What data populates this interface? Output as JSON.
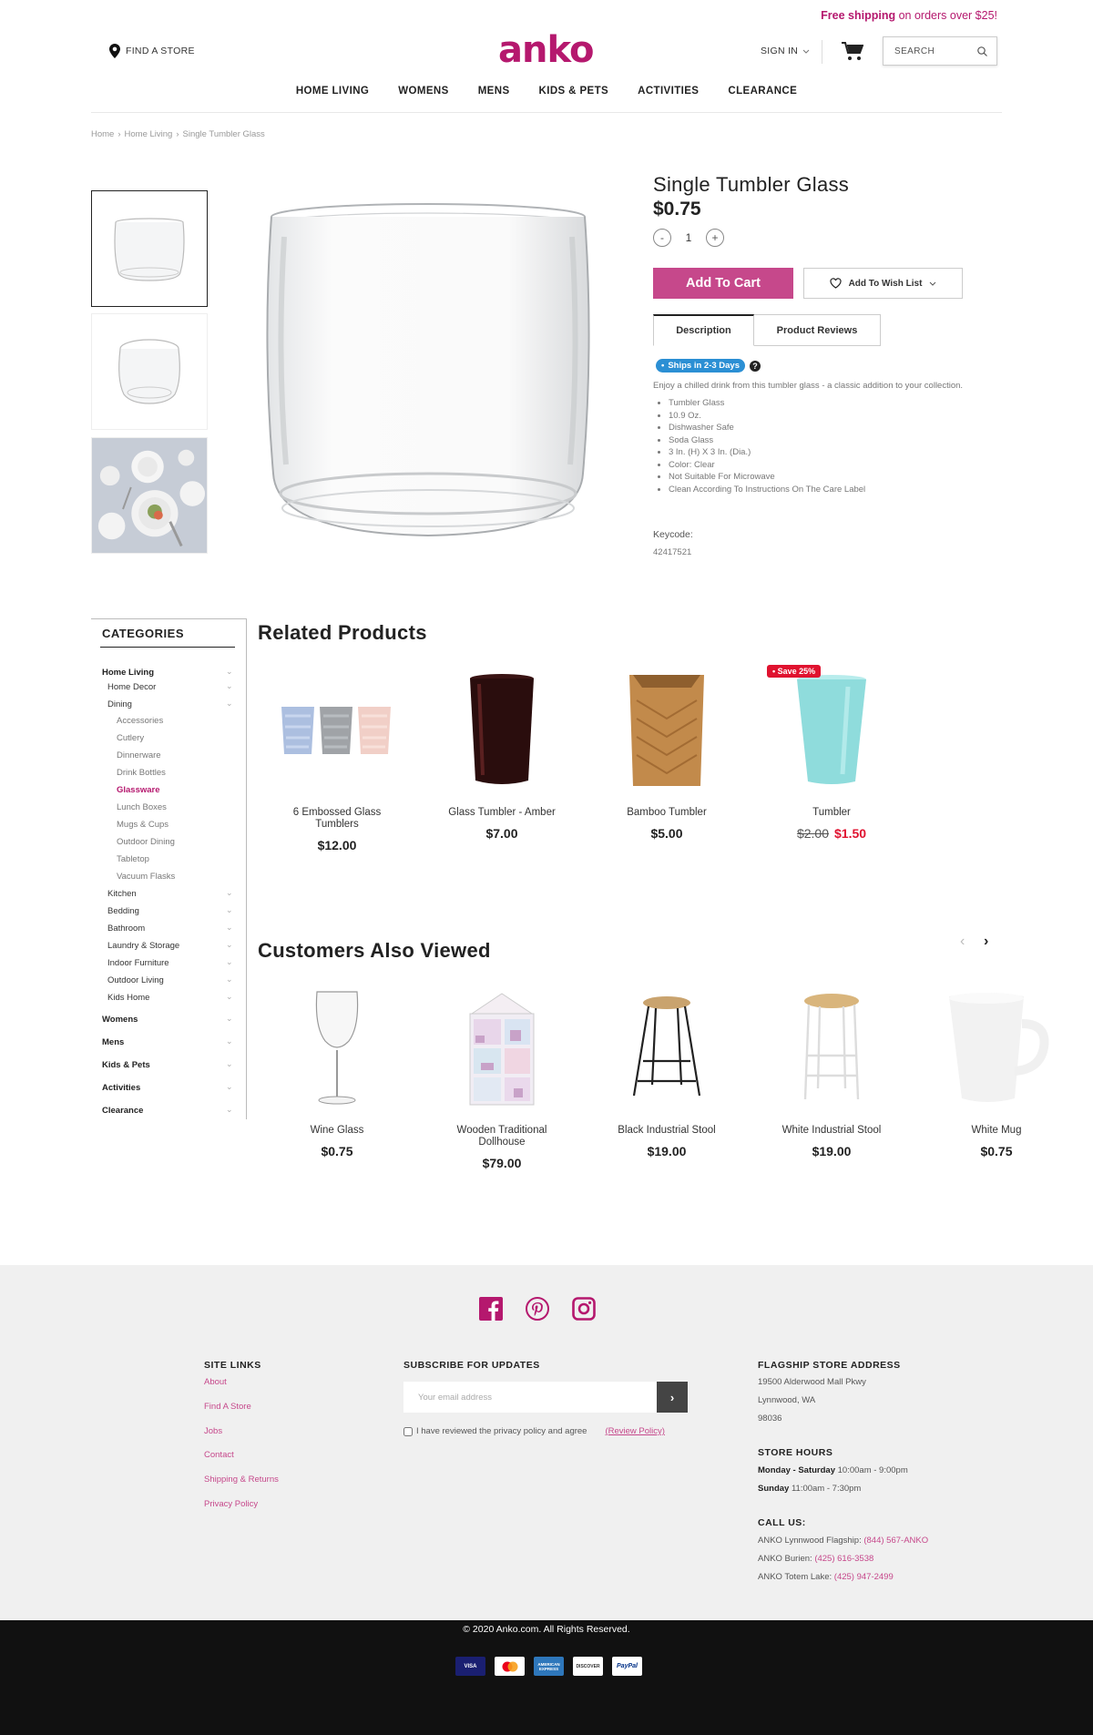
{
  "header": {
    "promo_bold": "Free shipping",
    "promo_rest": " on orders over $25!",
    "find_store": "FIND A STORE",
    "logo": "anko",
    "sign_in": "SIGN IN",
    "search_placeholder": "SEARCH",
    "nav": [
      "HOME LIVING",
      "WOMENS",
      "MENS",
      "KIDS & PETS",
      "ACTIVITIES",
      "CLEARANCE"
    ]
  },
  "breadcrumb": [
    "Home",
    "Home Living",
    "Single Tumbler Glass"
  ],
  "product": {
    "title": "Single Tumbler Glass",
    "price": "$0.75",
    "qty_minus": "-",
    "qty": "1",
    "qty_plus": "+",
    "add_to_cart": "Add To Cart",
    "wish_list": "Add To Wish List",
    "tabs": [
      "Description",
      "Product Reviews"
    ],
    "ships": "Ships in 2-3 Days",
    "help": "?",
    "description": "Enjoy a chilled drink from this tumbler glass - a classic addition to your collection.",
    "features": [
      "Tumbler Glass",
      "10.9 Oz.",
      "Dishwasher Safe",
      "Soda Glass",
      "3 In. (H) X 3 In. (Dia.)",
      "Color: Clear",
      "Not Suitable For Microwave",
      "Clean According To Instructions On The Care Label"
    ],
    "keycode_label": "Keycode:",
    "keycode": "42417521"
  },
  "categories": {
    "title": "CATEGORIES",
    "items": [
      {
        "label": "Home Living",
        "level": 1
      },
      {
        "label": "Home Decor",
        "level": 2
      },
      {
        "label": "Dining",
        "level": 2
      },
      {
        "label": "Accessories",
        "level": 3
      },
      {
        "label": "Cutlery",
        "level": 3
      },
      {
        "label": "Dinnerware",
        "level": 3
      },
      {
        "label": "Drink Bottles",
        "level": 3
      },
      {
        "label": "Glassware",
        "level": 3,
        "active": true
      },
      {
        "label": "Lunch Boxes",
        "level": 3
      },
      {
        "label": "Mugs & Cups",
        "level": 3
      },
      {
        "label": "Outdoor Dining",
        "level": 3
      },
      {
        "label": "Tabletop",
        "level": 3
      },
      {
        "label": "Vacuum Flasks",
        "level": 3
      },
      {
        "label": "Kitchen",
        "level": 2
      },
      {
        "label": "Bedding",
        "level": 2
      },
      {
        "label": "Bathroom",
        "level": 2
      },
      {
        "label": "Laundry & Storage",
        "level": 2
      },
      {
        "label": "Indoor Furniture",
        "level": 2
      },
      {
        "label": "Outdoor Living",
        "level": 2
      },
      {
        "label": "Kids Home",
        "level": 2
      },
      {
        "label": "Womens",
        "level": 1
      },
      {
        "label": "Mens",
        "level": 1
      },
      {
        "label": "Kids & Pets",
        "level": 1
      },
      {
        "label": "Activities",
        "level": 1
      },
      {
        "label": "Clearance",
        "level": 1
      }
    ]
  },
  "related": {
    "title": "Related Products",
    "items": [
      {
        "name": "6 Embossed Glass Tumblers",
        "price": "$12.00"
      },
      {
        "name": "Glass Tumbler - Amber",
        "price": "$7.00"
      },
      {
        "name": "Bamboo Tumbler",
        "price": "$5.00"
      },
      {
        "name": "Tumbler",
        "old_price": "$2.00",
        "price": "$1.50",
        "badge": "Save 25%"
      }
    ]
  },
  "also_viewed": {
    "title": "Customers Also Viewed",
    "prev": "‹",
    "next": "›",
    "items": [
      {
        "name": "Wine Glass",
        "price": "$0.75"
      },
      {
        "name": "Wooden Traditional Dollhouse",
        "price": "$79.00"
      },
      {
        "name": "Black Industrial Stool",
        "price": "$19.00"
      },
      {
        "name": "White Industrial Stool",
        "price": "$19.00"
      },
      {
        "name": "White Mug",
        "price": "$0.75"
      }
    ]
  },
  "footer": {
    "site_links_title": "SITE LINKS",
    "site_links": [
      "About",
      "Find A Store",
      "Jobs",
      "Contact",
      "Shipping & Returns",
      "Privacy Policy"
    ],
    "subscribe_title": "SUBSCRIBE FOR UPDATES",
    "email_placeholder": "Your email address",
    "submit": "›",
    "consent": "I have reviewed the privacy policy and agree",
    "review_policy": "(Review Policy)",
    "address_title": "FLAGSHIP STORE ADDRESS",
    "address": [
      "19500 Alderwood Mall Pkwy",
      "Lynnwood, WA",
      "98036"
    ],
    "hours_title": "STORE HOURS",
    "hours": [
      {
        "days": "Monday - Saturday",
        "time": " 10:00am - 9:00pm"
      },
      {
        "days": "Sunday",
        "time": " 11:00am - 7:30pm"
      }
    ],
    "call_title": "CALL US:",
    "phones": [
      {
        "label": "ANKO Lynnwood Flagship: ",
        "number": "(844) 567-ANKO"
      },
      {
        "label": "ANKO Burien: ",
        "number": "(425) 616-3538"
      },
      {
        "label": "ANKO Totem Lake: ",
        "number": "(425) 947-2499"
      }
    ],
    "copyright": "© 2020 Anko.com. All Rights Reserved.",
    "payments": [
      "VISA",
      "MC",
      "AMERICAN EXPRESS",
      "DISCOVER",
      "PayPal"
    ]
  },
  "colors": {
    "brand": "#b5186e",
    "button": "#c6488b",
    "sale": "#e0122f",
    "ships_badge": "#2b8fd4"
  }
}
